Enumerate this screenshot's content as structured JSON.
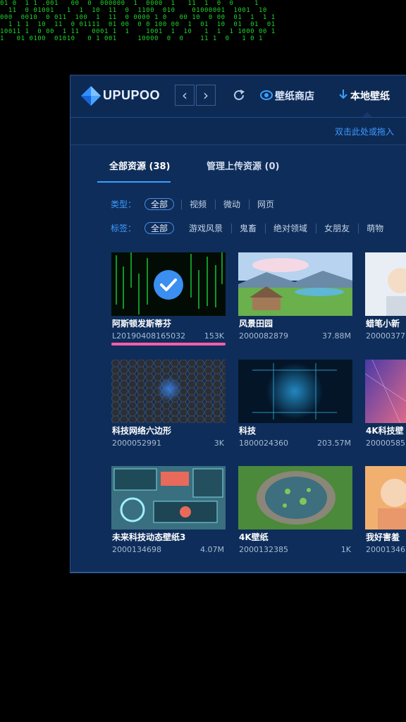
{
  "background_code_lines": [
    "01 0  1 1 .001   00  0  000000  1  0000  1   11  1  0  0     1",
    "  11  0 01001   1  1  10  11  0  1100  010    01000001  1001  10",
    "000  0010  0 011  100  1  11  0 0000 1 0   00 10  0 00  01  1  1 1",
    "  1 1 1  10  11  0 01111  01 00  0 0 100 00  1  01  10  01  01  01",
    "10011 1  0 00  1 11   0001 1  1    1001  1  10   1  1  1 1000 00 1",
    "1   01 0100  01010   0 1 001     10000  0  0    11 1  0   1 0 1"
  ],
  "app": {
    "logo_text": "UPUPOO",
    "nav_back": "‹",
    "nav_forward": "›",
    "store_label": "壁纸商店",
    "local_label": "本地壁纸",
    "drop_hint": "双击此处或拖入",
    "tabs": [
      {
        "label": "全部资源 (38)",
        "active": true
      },
      {
        "label": "管理上传资源 (0)",
        "active": false
      }
    ],
    "filters": {
      "type_label": "类型：",
      "type_selected": "全部",
      "type_options": [
        "视频",
        "微动",
        "网页"
      ],
      "tag_label": "标签：",
      "tag_selected": "全部",
      "tag_options": [
        "游戏风景",
        "鬼畜",
        "绝对领域",
        "女朋友",
        "萌物"
      ]
    },
    "cards": [
      {
        "title": "阿斯顿发斯蒂芬",
        "id": "L20190408165032",
        "size": "153K",
        "selected": true,
        "progress": 1.0
      },
      {
        "title": "风景田园",
        "id": "2000082879",
        "size": "37.88M"
      },
      {
        "title": "蜡笔小新",
        "id": "20000377",
        "size": ""
      },
      {
        "title": "科技网络六边形",
        "id": "2000052991",
        "size": "3K"
      },
      {
        "title": "科技",
        "id": "1800024360",
        "size": "203.57M"
      },
      {
        "title": "4K科技壁",
        "id": "20000585",
        "size": ""
      },
      {
        "title": "未来科技动态壁纸3",
        "id": "2000134698",
        "size": "4.07M"
      },
      {
        "title": "4K壁纸",
        "id": "2000132385",
        "size": "1K"
      },
      {
        "title": "我好害羞",
        "id": "20001346",
        "size": ""
      }
    ]
  },
  "colors": {
    "app_bg": "#0e2d5a",
    "accent": "#3aa0ff",
    "progress": "#ff5ea8",
    "matrix_green": "#1fd32c"
  }
}
